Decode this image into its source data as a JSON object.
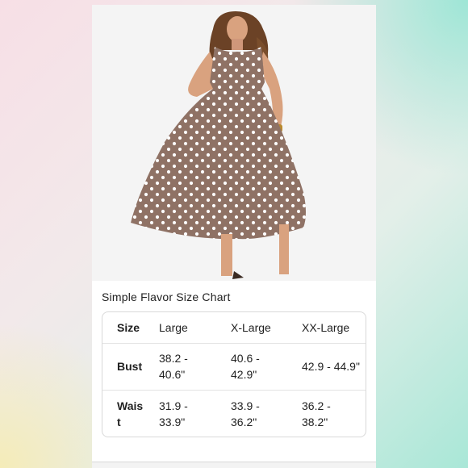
{
  "product": {
    "image_alt": "brown polka dot sleeveless midi dress"
  },
  "size_chart": {
    "title": "Simple Flavor Size Chart",
    "header": {
      "label": "Size",
      "columns": [
        "Large",
        "X-Large",
        "XX-Large"
      ]
    },
    "rows": [
      {
        "label": "Bust",
        "values": [
          "38.2 - 40.6\"",
          "40.6 - 42.9\"",
          "42.9 - 44.9\""
        ]
      },
      {
        "label": "Waist",
        "values": [
          "31.9 - 33.9\"",
          "33.9 - 36.2\"",
          "36.2 - 38.2\""
        ]
      }
    ]
  },
  "colors": {
    "dress": "#8f7265",
    "dots": "#ffffff",
    "skin": "#d9a27f",
    "hair": "#6b4226"
  }
}
